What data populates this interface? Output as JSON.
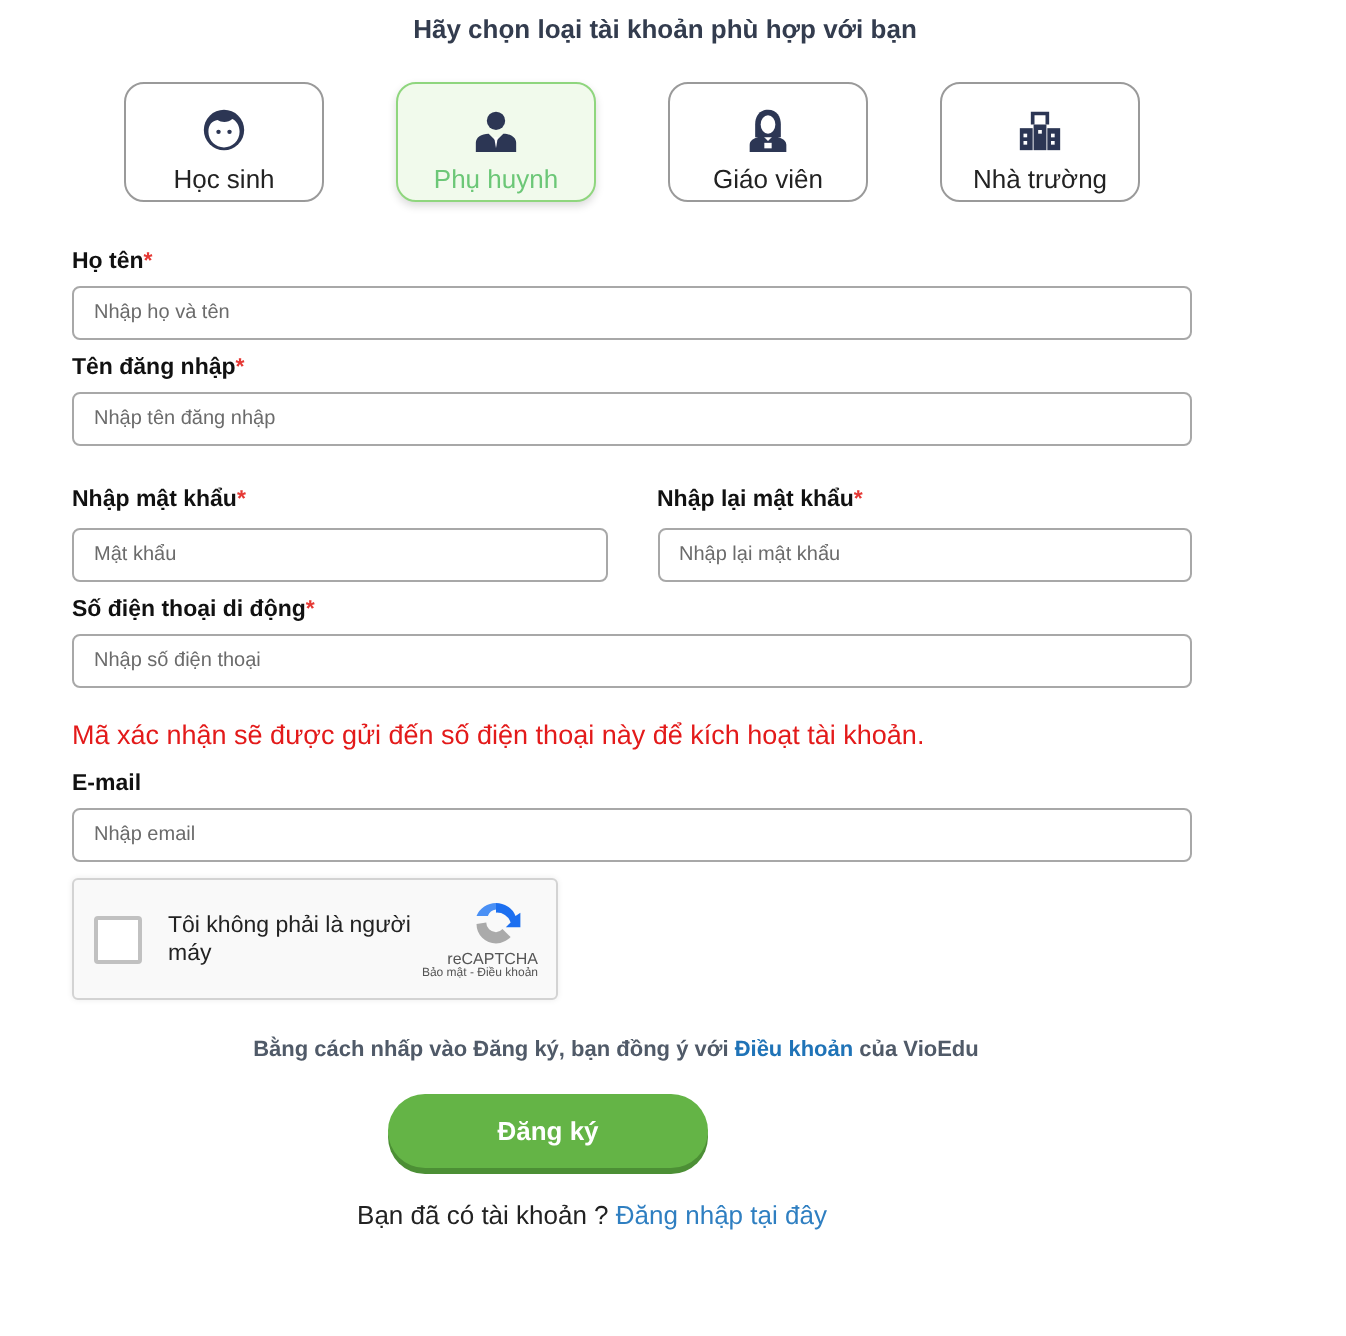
{
  "heading": "Hãy chọn loại tài khoản phù hợp với bạn",
  "roles": [
    {
      "label": "Học sinh",
      "kind": "student",
      "selected": false
    },
    {
      "label": "Phụ huynh",
      "kind": "parent",
      "selected": true
    },
    {
      "label": "Giáo viên",
      "kind": "teacher",
      "selected": false
    },
    {
      "label": "Nhà trường",
      "kind": "school",
      "selected": false
    }
  ],
  "form_rows": [
    {
      "fields": [
        {
          "label": "Họ tên",
          "required_mark": "*",
          "placeholder": "Nhập họ và tên"
        }
      ]
    },
    {
      "fields": [
        {
          "label": "Tên đăng nhập",
          "required_mark": "*",
          "placeholder": "Nhập tên đăng nhập"
        }
      ]
    },
    {
      "fields": [
        {
          "label": "Nhập mật khẩu",
          "required_mark": "*",
          "placeholder": "Mật khẩu"
        },
        {
          "label": "Nhập lại mật khẩu",
          "required_mark": "*",
          "placeholder": "Nhập lại mật khẩu"
        }
      ]
    },
    {
      "fields": [
        {
          "label": "Số điện thoại di động",
          "required_mark": "*",
          "placeholder": "Nhập số điện thoại"
        }
      ],
      "notice": "Mã xác nhận sẽ được gửi đến số điện thoại này để kích hoạt tài khoản."
    },
    {
      "fields": [
        {
          "label": "E-mail",
          "placeholder": "Nhập email"
        }
      ]
    }
  ],
  "captcha": {
    "label": "Tôi không phải là người máy",
    "checked": false,
    "brand": "reCAPTCHA",
    "links": "Bảo mật - Điều khoản"
  },
  "terms": {
    "before": "Bằng cách nhấp vào Đăng ký, bạn đồng ý với",
    "link": "Điều khoản",
    "after": "của VioEdu"
  },
  "submit": "Đăng ký",
  "login": {
    "question": "Bạn đã có tài khoản ?",
    "link": "Đăng nhập tại đây"
  }
}
